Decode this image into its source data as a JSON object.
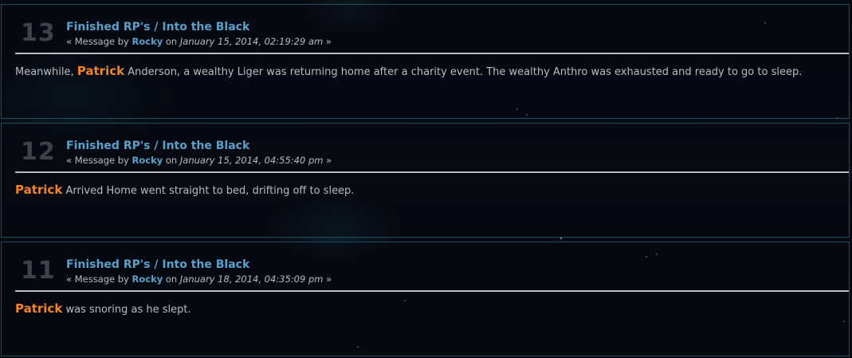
{
  "posts": [
    {
      "number": "13",
      "board": "Finished RP's",
      "separator": "/",
      "topic": "Into the Black",
      "meta_prefix": "« Message by",
      "author": "Rocky",
      "meta_on": "on",
      "date": "January 15, 2014, 02:19:29 am",
      "meta_suffix": "»",
      "body_prefix": "Meanwhile,",
      "body_name": "Patrick",
      "body_text": "Anderson, a wealthy Liger was returning home after a charity event. The wealthy Anthro was exhausted and ready to go to sleep."
    },
    {
      "number": "12",
      "board": "Finished RP's",
      "separator": "/",
      "topic": "Into the Black",
      "meta_prefix": "« Message by",
      "author": "Rocky",
      "meta_on": "on",
      "date": "January 15, 2014, 04:55:40 pm",
      "meta_suffix": "»",
      "body_prefix": "",
      "body_name": "Patrick",
      "body_text": "Arrived Home went straight to bed, drifting off to sleep."
    },
    {
      "number": "11",
      "board": "Finished RP's",
      "separator": "/",
      "topic": "Into the Black",
      "meta_prefix": "« Message by",
      "author": "Rocky",
      "meta_on": "on",
      "date": "January 18, 2014, 04:35:09 pm",
      "meta_suffix": "»",
      "body_prefix": "",
      "body_name": "Patrick",
      "body_text": "was snoring as he slept."
    }
  ],
  "colors": {
    "link": "#5aa0c8",
    "highlight_name": "#f28427",
    "text": "#b9bdc1",
    "post_number": "#3f4347",
    "border": "#1c4f5c"
  }
}
